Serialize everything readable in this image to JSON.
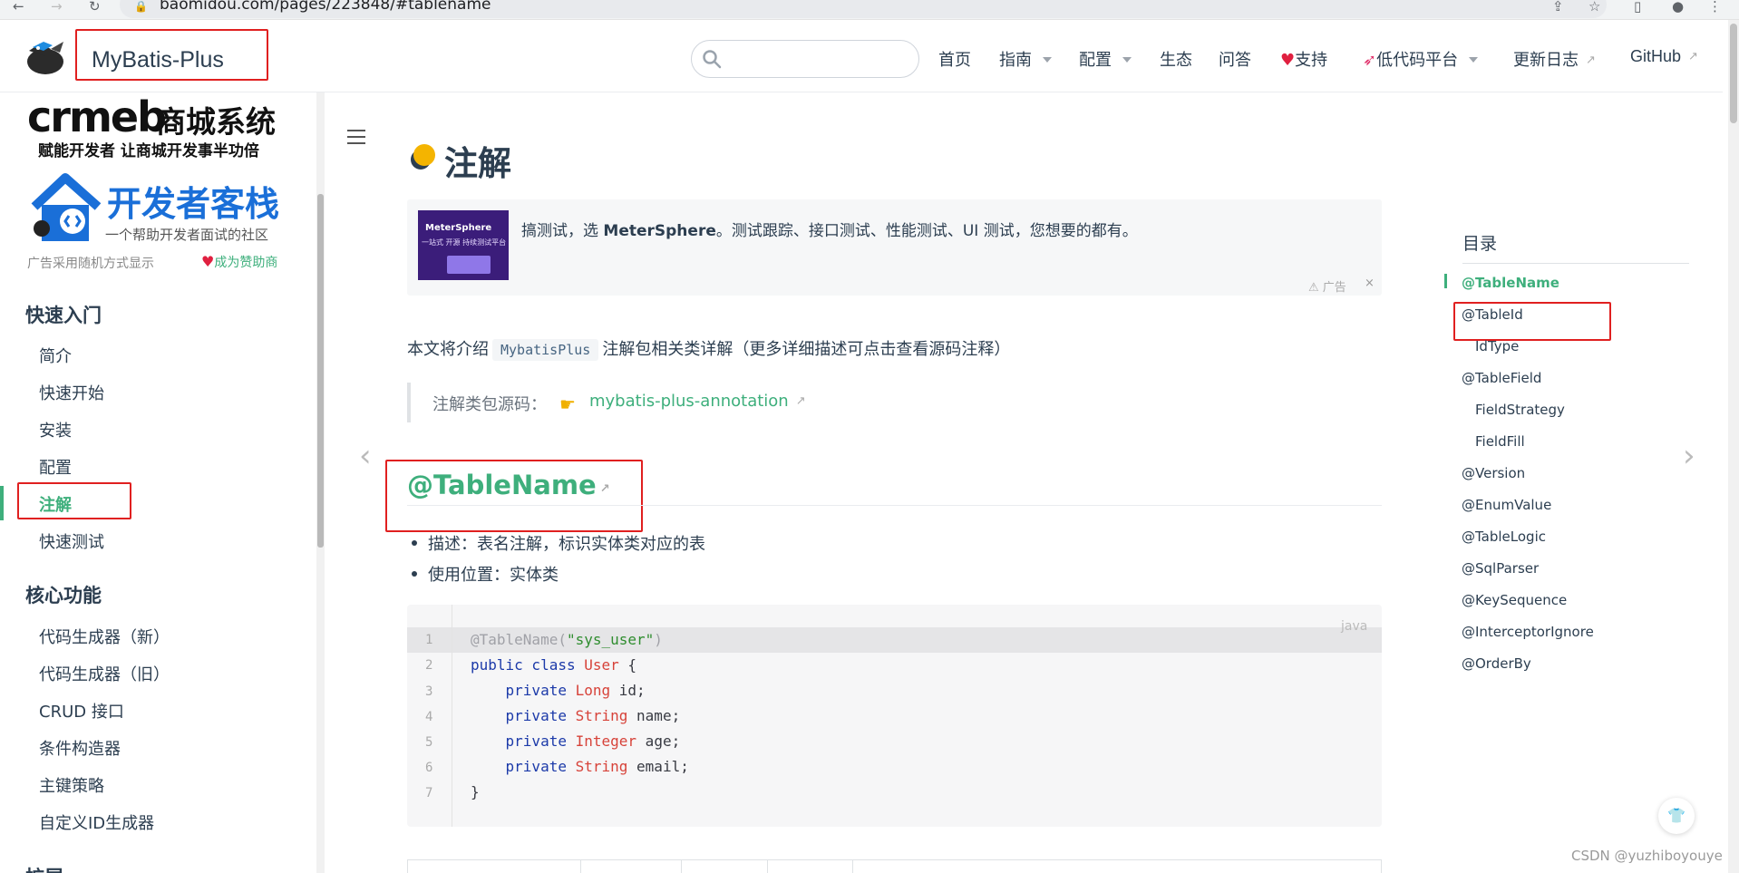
{
  "browser": {
    "url": "baomidou.com/pages/223848/#tablename"
  },
  "header": {
    "site_name": "MyBatis-Plus",
    "nav": [
      {
        "label": "首页"
      },
      {
        "label": "指南",
        "dropdown": true
      },
      {
        "label": "配置",
        "dropdown": true
      },
      {
        "label": "生态"
      },
      {
        "label": "问答"
      },
      {
        "label": "支持",
        "icon": "heart-icon"
      },
      {
        "label": "低代码平台",
        "icon": "rocket-icon",
        "dropdown": true
      },
      {
        "label": "更新日志",
        "external": true
      },
      {
        "label": "GitHub",
        "external": true
      }
    ]
  },
  "sidebar": {
    "banner": {
      "brand": "crmeb",
      "brand_cn": "商城系统",
      "tagline": "赋能开发者 让商城开发事半功倍",
      "dev_title": "开发者客栈",
      "dev_sub": "一个帮助开发者面试的社区",
      "ad_note": "广告采用随机方式显示",
      "sponsor": "成为赞助商"
    },
    "groups": [
      {
        "title": "快速入门",
        "items": [
          "简介",
          "快速开始",
          "安装",
          "配置",
          "注解",
          "快速测试"
        ]
      },
      {
        "title": "核心功能",
        "items": [
          "代码生成器（新）",
          "代码生成器（旧）",
          "CRUD 接口",
          "条件构造器",
          "主键策略",
          "自定义ID生成器"
        ]
      },
      {
        "title": "扩展",
        "items": []
      }
    ],
    "active_item": "注解"
  },
  "content": {
    "title": "注解",
    "ad": {
      "thumb_brand": "MeterSphere",
      "thumb_sub": "一站式 开源 持续测试平台",
      "text_prefix": "搞测试，选 ",
      "text_brand": "MeterSphere",
      "text_suffix": "。测试跟踪、接口测试、性能测试、UI 测试，您想要的都有。",
      "flag": "广告",
      "close": "×"
    },
    "intro_prefix": "本文将介绍",
    "intro_code": "MybatisPlus",
    "intro_suffix": "注解包相关类详解（更多详细描述可点击查看源码注释）",
    "source_label": "注解类包源码：",
    "source_link": "mybatis-plus-annotation",
    "section_heading": "@TableName",
    "bullets": [
      "描述：表名注解，标识实体类对应的表",
      "使用位置：实体类"
    ],
    "code": {
      "lang": "java",
      "line_numbers": [
        "1",
        "2",
        "3",
        "4",
        "5",
        "6",
        "7"
      ]
    }
  },
  "toc": {
    "title": "目录",
    "items": [
      {
        "label": "@TableName",
        "level": 1,
        "active": true
      },
      {
        "label": "@TableId",
        "level": 1
      },
      {
        "label": "IdType",
        "level": 2
      },
      {
        "label": "@TableField",
        "level": 1
      },
      {
        "label": "FieldStrategy",
        "level": 2
      },
      {
        "label": "FieldFill",
        "level": 2
      },
      {
        "label": "@Version",
        "level": 1
      },
      {
        "label": "@EnumValue",
        "level": 1
      },
      {
        "label": "@TableLogic",
        "level": 1
      },
      {
        "label": "@SqlParser",
        "level": 1
      },
      {
        "label": "@KeySequence",
        "level": 1
      },
      {
        "label": "@InterceptorIgnore",
        "level": 1
      },
      {
        "label": "@OrderBy",
        "level": 1
      }
    ]
  },
  "watermark": "CSDN @yuzhiboyouye",
  "colors": {
    "accent": "#3eaf7c",
    "text": "#2c3e50",
    "highlight_box": "#e02020"
  }
}
